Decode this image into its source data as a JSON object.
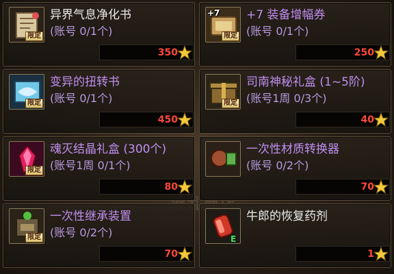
{
  "watermark": "混乱商店",
  "badge_label": "限定",
  "items": [
    {
      "name": "异界气息净化书",
      "name_color": "white",
      "limit": "(账号 0/1个)",
      "price": "350",
      "icon": "scroll-icon",
      "badge": true,
      "plus": ""
    },
    {
      "name": "+7 装备增幅券",
      "name_color": "purple",
      "limit": "(账号 0/1个)",
      "price": "250",
      "icon": "amplify-ticket-icon",
      "badge": true,
      "plus": "+7"
    },
    {
      "name": "变异的扭转书",
      "name_color": "purple",
      "limit": "(账号 0/1个)",
      "price": "450",
      "icon": "twist-book-icon",
      "badge": true,
      "plus": ""
    },
    {
      "name": "司南神秘礼盒 (1~5阶)",
      "name_color": "purple",
      "limit": "(账号1周 0/3个)",
      "price": "40",
      "icon": "mystery-box-icon",
      "badge": true,
      "plus": ""
    },
    {
      "name": "魂灭结晶礼盒 (300个)",
      "name_color": "purple",
      "limit": "(账号1周 0/1个)",
      "price": "80",
      "icon": "crystal-box-icon",
      "badge": true,
      "plus": ""
    },
    {
      "name": "一次性材质转换器",
      "name_color": "purple",
      "limit": "(账号 0/2个)",
      "price": "70",
      "icon": "material-converter-icon",
      "badge": true,
      "plus": ""
    },
    {
      "name": "一次性继承装置",
      "name_color": "purple",
      "limit": "(账号 0/2个)",
      "price": "70",
      "icon": "inherit-device-icon",
      "badge": true,
      "plus": ""
    },
    {
      "name": "牛郎的恢复药剂",
      "name_color": "white",
      "limit": "",
      "price": "1",
      "icon": "recovery-potion-icon",
      "badge": false,
      "plus": ""
    }
  ]
}
